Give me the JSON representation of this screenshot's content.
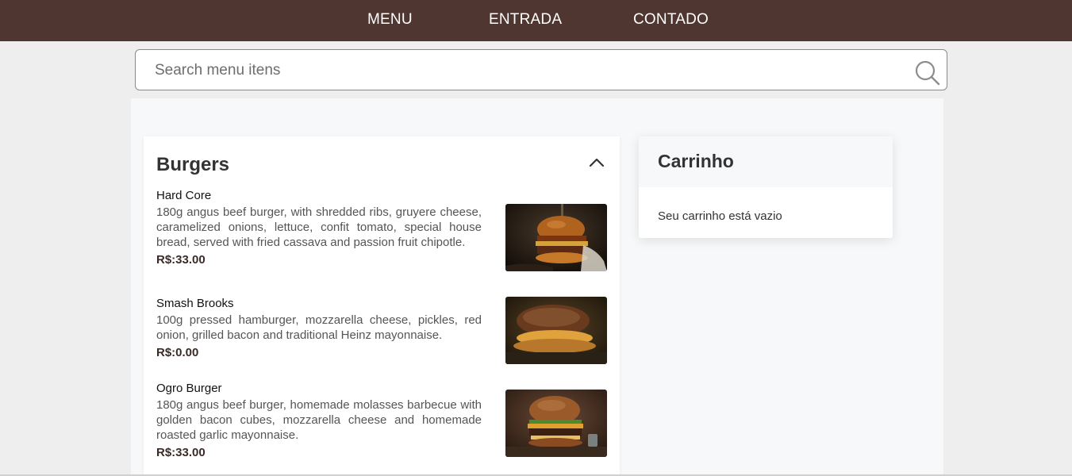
{
  "nav": {
    "items": [
      "MENU",
      "ENTRADA",
      "CONTADO"
    ]
  },
  "search": {
    "placeholder": "Search menu itens"
  },
  "menu": {
    "category": "Burgers",
    "items": [
      {
        "name": "Hard Core",
        "description": "180g angus beef burger, with shredded ribs, gruyere cheese, caramelized onions, lettuce, confit tomato, special house bread, served with fried cassava and passion fruit chipotle.",
        "price": "R$:33.00"
      },
      {
        "name": "Smash Brooks",
        "description": "100g pressed hamburger, mozzarella cheese, pickles, red onion, grilled bacon and traditional Heinz mayonnaise.",
        "price": "R$:0.00"
      },
      {
        "name": "Ogro Burger",
        "description": "180g angus beef burger, homemade molasses barbecue with golden bacon cubes, mozzarella cheese and homemade roasted garlic mayonnaise.",
        "price": "R$:33.00"
      }
    ]
  },
  "cart": {
    "title": "Carrinho",
    "empty_text": "Seu carrinho está vazio"
  },
  "colors": {
    "nav_bg": "#503630",
    "price_text": "#3a2b27"
  }
}
